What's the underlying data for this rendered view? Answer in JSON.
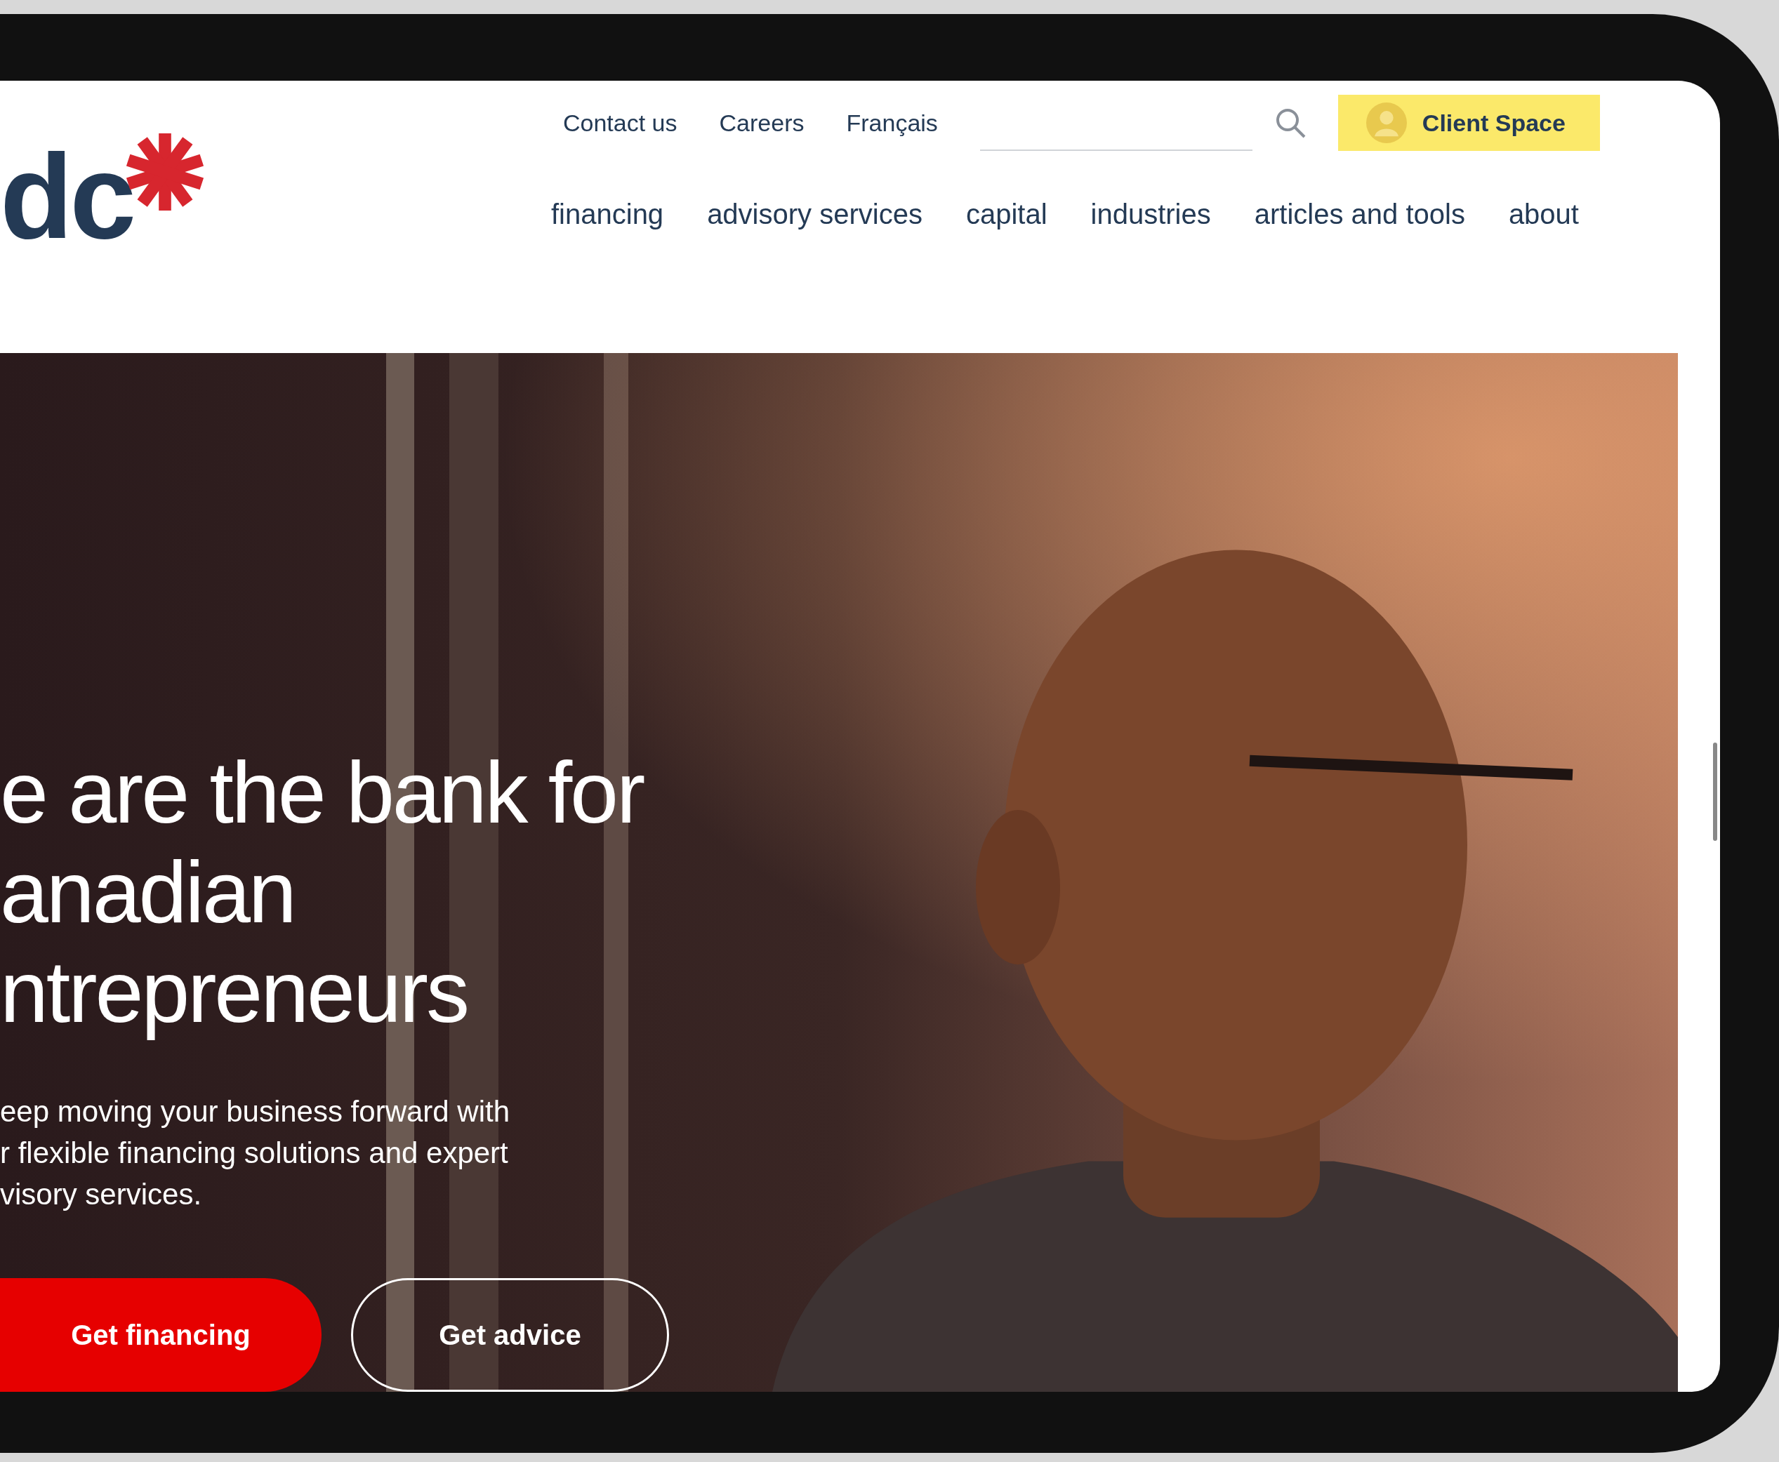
{
  "logo": {
    "text": "dc"
  },
  "utility_nav": [
    "Contact us",
    "Careers",
    "Français"
  ],
  "client_button": {
    "label": "Client Space"
  },
  "main_nav": [
    "financing",
    "advisory services",
    "capital",
    "industries",
    "articles and tools",
    "about"
  ],
  "hero": {
    "headline_lines": [
      "e are the bank for",
      "anadian",
      "ntrepreneurs"
    ],
    "body_lines": [
      "eep moving your business forward with",
      "r flexible financing solutions and expert",
      "visory services."
    ],
    "buttons": [
      {
        "label": "Get financing",
        "kind": "primary"
      },
      {
        "label": "Get advice",
        "kind": "outline"
      }
    ]
  }
}
